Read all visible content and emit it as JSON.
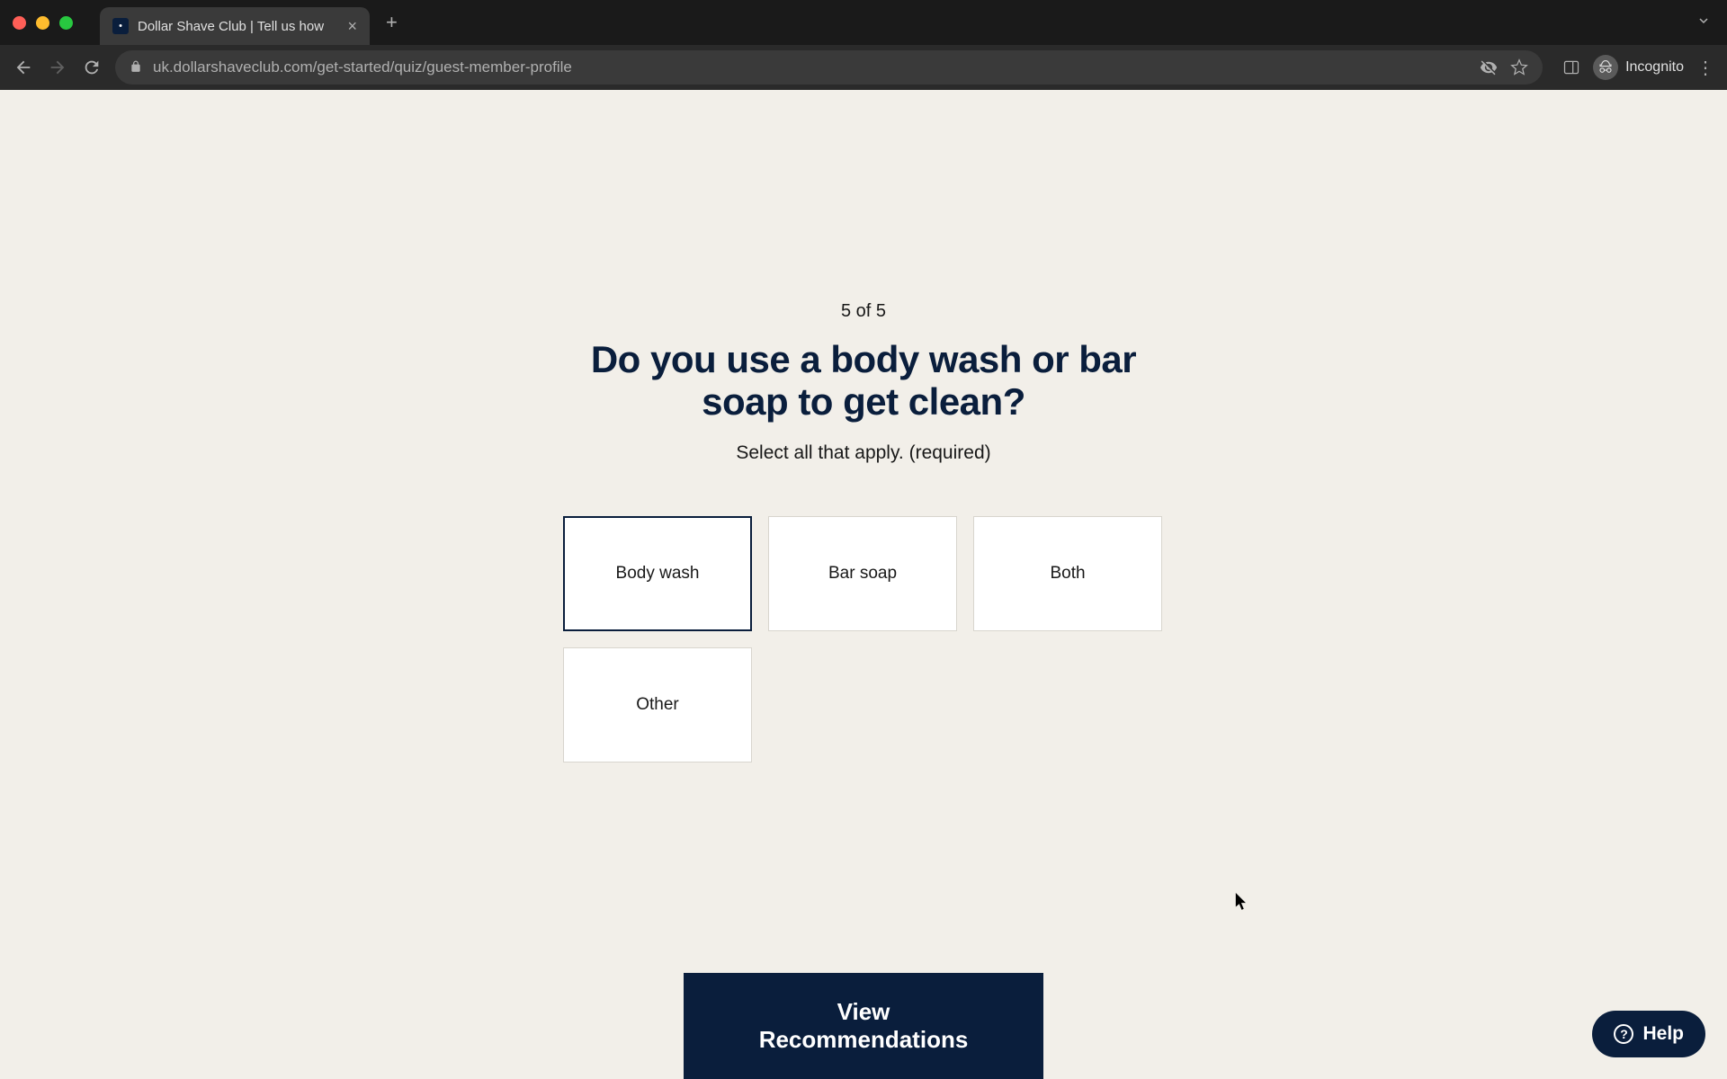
{
  "browser": {
    "tab_title": "Dollar Shave Club | Tell us how",
    "url": "uk.dollarshaveclub.com/get-started/quiz/guest-member-profile",
    "incognito_label": "Incognito"
  },
  "quiz": {
    "progress": "5 of 5",
    "question": "Do you use a body wash or bar soap to get clean?",
    "instruction": "Select all that apply. (required)",
    "options": [
      {
        "label": "Body wash",
        "selected": true
      },
      {
        "label": "Bar soap",
        "selected": false
      },
      {
        "label": "Both",
        "selected": false
      },
      {
        "label": "Other",
        "selected": false
      }
    ],
    "cta_label": "View Recommendations"
  },
  "help": {
    "label": "Help"
  }
}
